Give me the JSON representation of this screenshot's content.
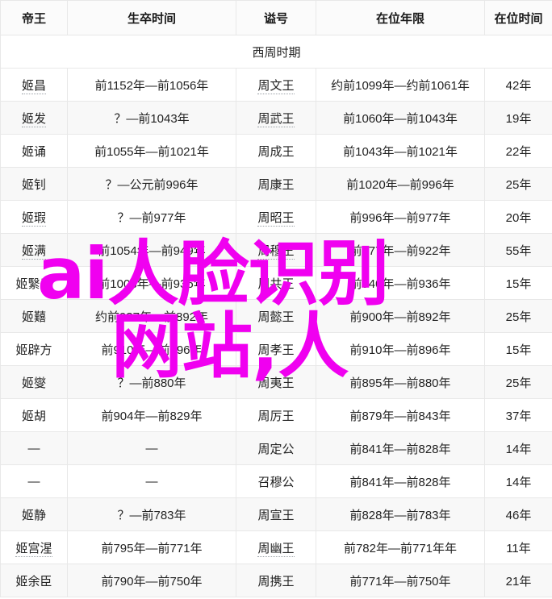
{
  "table": {
    "columns": [
      "帝王",
      "生卒时间",
      "谥号",
      "在位年限",
      "在位时间"
    ],
    "sections": [
      {
        "title": "西周时期",
        "rows": [
          {
            "name": "姬昌",
            "name_link": true,
            "life": "前1152年—前1056年",
            "posthumous": "周文王",
            "post_link": true,
            "reign": "约前1099年—约前1061年",
            "years": "42年"
          },
          {
            "name": "姬发",
            "name_link": true,
            "life": "？—前1043年",
            "posthumous": "周武王",
            "post_link": true,
            "reign": "前1060年—前1043年",
            "years": "19年"
          },
          {
            "name": "姬诵",
            "name_link": false,
            "life": "前1055年—前1021年",
            "posthumous": "周成王",
            "post_link": false,
            "reign": "前1043年—前1021年",
            "years": "22年"
          },
          {
            "name": "姬钊",
            "name_link": false,
            "life": "？—公元前996年",
            "posthumous": "周康王",
            "post_link": false,
            "reign": "前1020年—前996年",
            "years": "25年"
          },
          {
            "name": "姬瑕",
            "name_link": true,
            "life": "？—前977年",
            "posthumous": "周昭王",
            "post_link": true,
            "reign": "前996年—前977年",
            "years": "20年"
          },
          {
            "name": "姬满",
            "name_link": true,
            "life": "前1054年—前949年",
            "posthumous": "周穆王",
            "post_link": true,
            "reign": "前977年—前922年",
            "years": "55年"
          },
          {
            "name": "姬繄扈",
            "name_link": false,
            "life": "前1003年—前936年",
            "posthumous": "周共王",
            "post_link": false,
            "reign": "前940年—前936年",
            "years": "15年"
          },
          {
            "name": "姬囏",
            "name_link": false,
            "life": "约前937年—前892年",
            "posthumous": "周懿王",
            "post_link": false,
            "reign": "前900年—前892年",
            "years": "25年"
          },
          {
            "name": "姬辟方",
            "name_link": false,
            "life": "前910年—前896年",
            "posthumous": "周孝王",
            "post_link": false,
            "reign": "前910年—前896年",
            "years": "15年"
          },
          {
            "name": "姬燮",
            "name_link": false,
            "life": "？—前880年",
            "posthumous": "周夷王",
            "post_link": false,
            "reign": "前895年—前880年",
            "years": "25年"
          },
          {
            "name": "姬胡",
            "name_link": false,
            "life": "前904年—前829年",
            "posthumous": "周厉王",
            "post_link": false,
            "reign": "前879年—前843年",
            "years": "37年"
          },
          {
            "name": "—",
            "name_link": false,
            "life": "—",
            "posthumous": "周定公",
            "post_link": false,
            "reign": "前841年—前828年",
            "years": "14年"
          },
          {
            "name": "—",
            "name_link": false,
            "life": "—",
            "posthumous": "召穆公",
            "post_link": false,
            "reign": "前841年—前828年",
            "years": "14年"
          },
          {
            "name": "姬静",
            "name_link": false,
            "life": "？—前783年",
            "posthumous": "周宣王",
            "post_link": false,
            "reign": "前828年—前783年",
            "years": "46年"
          },
          {
            "name": "姬宫湦",
            "name_link": true,
            "life": "前795年—前771年",
            "posthumous": "周幽王",
            "post_link": true,
            "reign": "前782年—前771年年",
            "years": "11年"
          },
          {
            "name": "姬余臣",
            "name_link": false,
            "life": "前790年—前750年",
            "posthumous": "周携王",
            "post_link": false,
            "reign": "前771年—前750年",
            "years": "21年"
          }
        ]
      }
    ]
  },
  "watermark": {
    "line1": "ai人脸识别",
    "line2": "网站,人",
    "color": "#f000f0"
  }
}
